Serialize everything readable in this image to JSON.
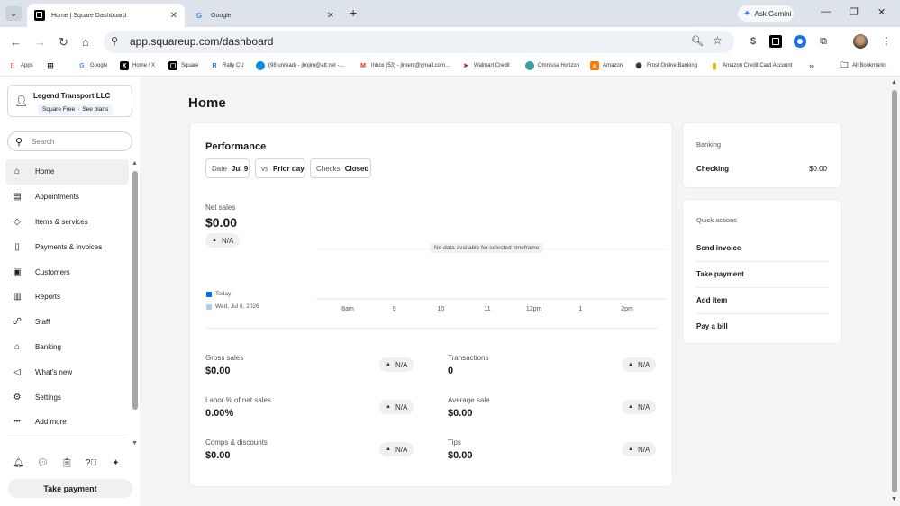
{
  "browser": {
    "tabs": [
      {
        "title": "Home | Square Dashboard",
        "active": true
      },
      {
        "title": "Google",
        "active": false
      }
    ],
    "gemini_label": "Ask Gemini",
    "url": "app.squareup.com/dashboard",
    "bookmarks": [
      {
        "label": "Apps",
        "icon": "apps-grid-icon"
      },
      {
        "label": "",
        "icon": "grid-icon"
      },
      {
        "label": "Google",
        "icon": "google-icon"
      },
      {
        "label": "Home / X",
        "icon": "x-icon"
      },
      {
        "label": "Square",
        "icon": "square-icon"
      },
      {
        "label": "Rally CU",
        "icon": "rally-icon"
      },
      {
        "label": "(98 unread) - jlrojim@att.net -...",
        "icon": "att-icon"
      },
      {
        "label": "Inbox (53) - jlroent@gmail.com...",
        "icon": "gmail-icon"
      },
      {
        "label": "Walmart Credit",
        "icon": "walmart-icon"
      },
      {
        "label": "Omnissa Horizon",
        "icon": "omnissa-icon"
      },
      {
        "label": "Amazon",
        "icon": "amazon-icon"
      },
      {
        "label": "Frost Online Banking",
        "icon": "frost-icon"
      },
      {
        "label": "Amazon Credit Card Account",
        "icon": "card-icon"
      }
    ],
    "all_bookmarks": "All Bookmarks"
  },
  "sidebar": {
    "business_name": "Legend Transport LLC",
    "plan": "Square Free",
    "plan_link": "See plans",
    "search_placeholder": "Search",
    "nav": [
      {
        "label": "Home",
        "icon": "home-icon",
        "glyph": "⌂",
        "active": true
      },
      {
        "label": "Appointments",
        "icon": "calendar-icon",
        "glyph": "▤"
      },
      {
        "label": "Items & services",
        "icon": "tag-icon",
        "glyph": "◇"
      },
      {
        "label": "Payments & invoices",
        "icon": "receipt-icon",
        "glyph": "▯"
      },
      {
        "label": "Customers",
        "icon": "contacts-icon",
        "glyph": "▣"
      },
      {
        "label": "Reports",
        "icon": "bar-chart-icon",
        "glyph": "▥"
      },
      {
        "label": "Staff",
        "icon": "team-icon",
        "glyph": "☍"
      },
      {
        "label": "Banking",
        "icon": "bank-icon",
        "glyph": "⌂"
      },
      {
        "label": "What's new",
        "icon": "megaphone-icon",
        "glyph": "◁"
      },
      {
        "label": "Settings",
        "icon": "gear-icon",
        "glyph": "⚙"
      },
      {
        "label": "Add more",
        "icon": "more-dots-icon",
        "glyph": "•••"
      }
    ],
    "take_payment": "Take payment"
  },
  "main": {
    "title": "Home",
    "performance": {
      "title": "Performance",
      "filters": [
        {
          "key": "Date",
          "value": "Jul 9"
        },
        {
          "key": "vs",
          "value": "Prior day"
        },
        {
          "key": "Checks",
          "value": "Closed"
        }
      ],
      "net_sales_label": "Net sales",
      "net_sales_value": "$0.00",
      "net_sales_change": "N/A",
      "no_data": "No data available for selected timeframe",
      "legend": [
        {
          "label": "Today",
          "color": "#006aff"
        },
        {
          "label": "Wed, Jul 8, 2026",
          "color": "#a9cdfb"
        }
      ],
      "metrics": [
        {
          "label": "Gross sales",
          "value": "$0.00",
          "change": "N/A"
        },
        {
          "label": "Transactions",
          "value": "0",
          "change": "N/A"
        },
        {
          "label": "Labor % of net sales",
          "value": "0.00%",
          "change": "N/A"
        },
        {
          "label": "Average sale",
          "value": "$0.00",
          "change": "N/A"
        },
        {
          "label": "Comps & discounts",
          "value": "$0.00",
          "change": "N/A"
        },
        {
          "label": "Tips",
          "value": "$0.00",
          "change": "N/A"
        }
      ]
    },
    "banking": {
      "header": "Banking",
      "account": "Checking",
      "balance": "$0.00"
    },
    "quick_actions": {
      "header": "Quick actions",
      "items": [
        "Send invoice",
        "Take payment",
        "Add item",
        "Pay a bill"
      ]
    }
  },
  "chart_data": {
    "type": "line",
    "x": [
      "8am",
      "9",
      "10",
      "11",
      "12pm",
      "1",
      "2pm"
    ],
    "series": [
      {
        "name": "Today",
        "values": []
      },
      {
        "name": "Wed, Jul 8, 2026",
        "values": []
      }
    ],
    "annotation": "No data available for selected timeframe",
    "grid": true
  }
}
